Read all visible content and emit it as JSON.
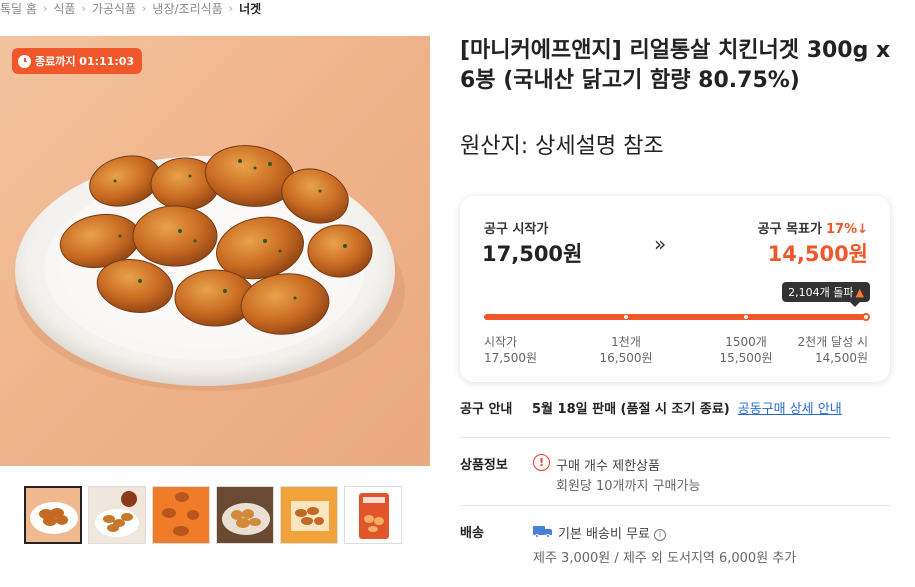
{
  "breadcrumb": [
    {
      "label": "톡딜 홈"
    },
    {
      "label": "식품"
    },
    {
      "label": "가공식품"
    },
    {
      "label": "냉장/조리식품"
    },
    {
      "label": "너겟"
    }
  ],
  "timer": {
    "label": "종료까지 01:11:03"
  },
  "product": {
    "title": "[마니커에프앤지] 리얼통살 치킨너겟 300g x 6봉 (국내산 닭고기 함량 80.75%)",
    "origin": "원산지: 상세설명 참조"
  },
  "group_buy": {
    "start_label": "공구 시작가",
    "start_price": "17,500원",
    "arrow": "»",
    "target_label": "공구 목표가",
    "target_discount": "17%↓",
    "target_price": "14,500원",
    "count_badge": "2,104개 돌파",
    "progress": 1.0,
    "tiers": [
      {
        "name": "시작가",
        "price": "17,500원"
      },
      {
        "name": "1천개",
        "price": "16,500원"
      },
      {
        "name": "1500개",
        "price": "15,500원"
      },
      {
        "name": "2천개 달성 시",
        "price": "14,500원"
      }
    ]
  },
  "notice": {
    "label": "공구 안내",
    "value": "5월 18일 판매 (품절 시 조기 종료)",
    "link": "공동구매 상세 안내"
  },
  "product_info": {
    "label": "상품정보",
    "line1": "구매 개수 제한상품",
    "line2": "회원당 10개까지 구매가능"
  },
  "shipping": {
    "label": "배송",
    "line1": "기본 배송비 무료",
    "line2": "제주 3,000원 / 제주 외 도서지역 6,000원 추가"
  },
  "thumbnails": [
    {
      "icon": "nugget-plate-thumb"
    },
    {
      "icon": "nugget-sauce-thumb"
    },
    {
      "icon": "nugget-falling-thumb"
    },
    {
      "icon": "nugget-table-thumb"
    },
    {
      "icon": "nugget-orange-thumb"
    },
    {
      "icon": "package-thumb"
    }
  ],
  "colors": {
    "accent": "#f0582c",
    "link": "#2a6bd4",
    "badge_dark": "#333333"
  }
}
